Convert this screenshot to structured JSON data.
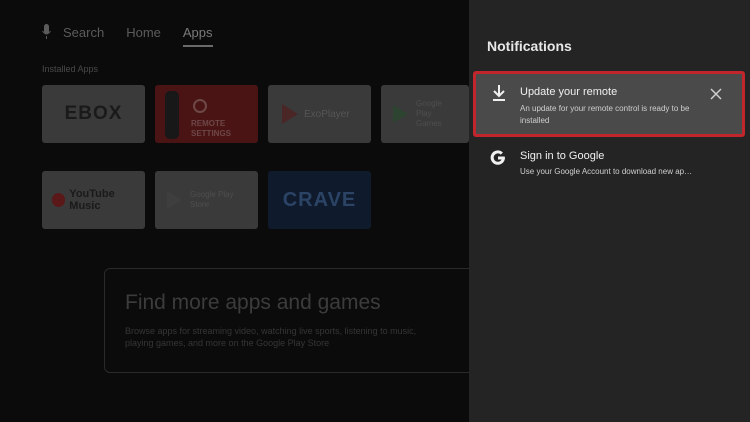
{
  "nav": {
    "search": "Search",
    "home": "Home",
    "apps": "Apps"
  },
  "installed_apps": {
    "label": "Installed Apps",
    "tiles": [
      {
        "name": "EBOX",
        "text": "EBOX"
      },
      {
        "name": "Remote Settings",
        "text": "REMOTE SETTINGS"
      },
      {
        "name": "ExoPlayer",
        "text": "ExoPlayer"
      },
      {
        "name": "Google Play Games",
        "text": "Google Play Games"
      },
      {
        "name": "YouTube Music",
        "text": "YouTube Music"
      },
      {
        "name": "Google Play Store",
        "text": "Google Play Store"
      },
      {
        "name": "Crave",
        "text": "CRAVE"
      }
    ]
  },
  "promo": {
    "title": "Find more apps and games",
    "description": "Browse apps for streaming video, watching live sports, listening to music, playing games, and more on the Google Play Store"
  },
  "notifications": {
    "title": "Notifications",
    "items": [
      {
        "icon": "download-icon",
        "title": "Update your remote",
        "body": "An update for your remote control is ready to be installed",
        "dismiss_icon": "close-icon"
      },
      {
        "icon": "google-icon",
        "title": "Sign in to Google",
        "body": "Use your Google Account to download new ap…"
      }
    ]
  },
  "colors": {
    "panel_bg": "#242424",
    "highlight_border": "#c0262b",
    "selected_item_bg": "#4a4a4a"
  }
}
